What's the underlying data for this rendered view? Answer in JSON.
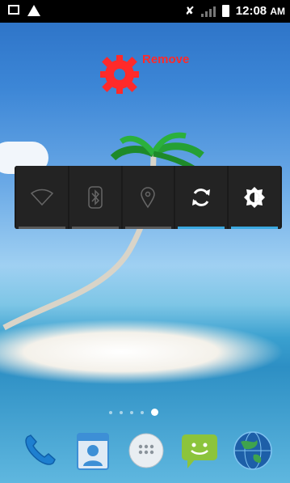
{
  "status_bar": {
    "time": "12:08",
    "time_suffix": "AM",
    "left_icons": [
      "picture-icon",
      "warning-icon"
    ],
    "right_icons": [
      "mute-icon",
      "no-signal-icon",
      "battery-icon"
    ]
  },
  "remove_target": {
    "label": "Remove",
    "icon": "gear-icon",
    "color": "#ff2a2a"
  },
  "quick_settings": {
    "tiles": [
      {
        "id": "wifi",
        "icon": "wifi-icon",
        "active": false
      },
      {
        "id": "bluetooth",
        "icon": "bluetooth-icon",
        "active": false
      },
      {
        "id": "location",
        "icon": "location-icon",
        "active": false
      },
      {
        "id": "sync",
        "icon": "sync-icon",
        "active": true
      },
      {
        "id": "brightness",
        "icon": "brightness-icon",
        "active": true
      }
    ],
    "active_color": "#3aa8e0"
  },
  "page_indicator": {
    "count": 5,
    "active_index": 4
  },
  "dock": {
    "apps": [
      {
        "id": "phone",
        "icon": "phone-icon"
      },
      {
        "id": "contacts",
        "icon": "contacts-icon"
      },
      {
        "id": "app-drawer",
        "icon": "app-drawer-icon"
      },
      {
        "id": "messaging",
        "icon": "messaging-icon"
      },
      {
        "id": "browser",
        "icon": "globe-icon"
      }
    ]
  }
}
